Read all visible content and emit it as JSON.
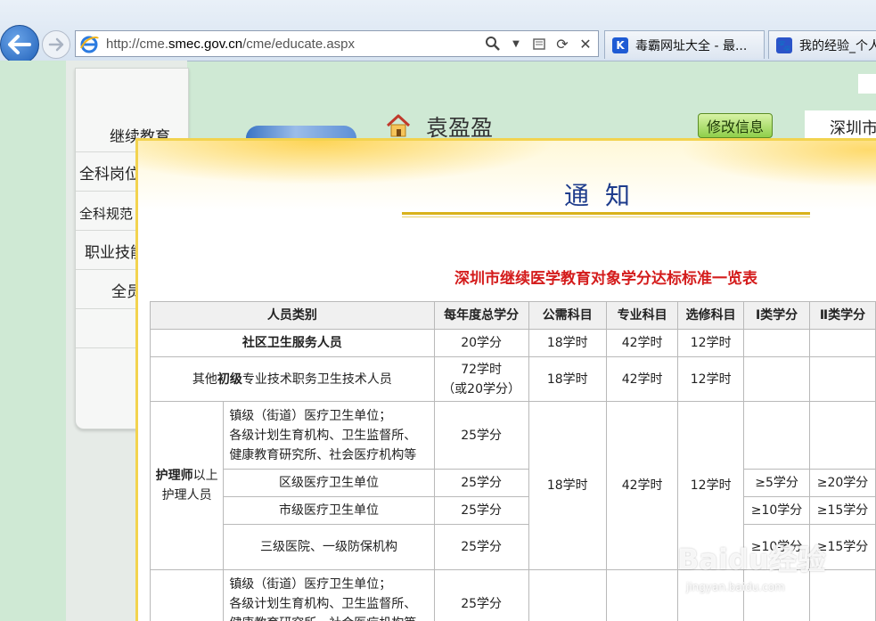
{
  "browser": {
    "url_prefix": "http://cme.",
    "url_domain": "smec.gov.cn",
    "url_path": "/cme/educate.aspx",
    "tabs": [
      {
        "label": "毒霸网址大全 - 最...",
        "icon": "kingsoft-icon",
        "icon_color": "#1e5bd4"
      },
      {
        "label": "我的经验_个人...",
        "icon": "baidu-paw-icon",
        "icon_color": "#2b54c9"
      }
    ]
  },
  "sidebar": {
    "items": [
      {
        "label": "继续教育"
      },
      {
        "label": "全科岗位"
      },
      {
        "label": "全科规范"
      },
      {
        "label": "职业技能"
      },
      {
        "label": "全员"
      }
    ]
  },
  "header": {
    "user_name": "袁盈盈",
    "edit_button": "修改信息",
    "city": "深圳市"
  },
  "notice": {
    "title": "通知",
    "subtitle": "深圳市继续医学教育对象学分达标标准一览表",
    "columns": [
      "人员类别",
      "每年度总学分",
      "公需科目",
      "专业科目",
      "选修科目",
      "Ⅰ类学分",
      "Ⅱ类学分"
    ],
    "rows": {
      "community": {
        "category": "社区卫生服务人员",
        "total": "20学分",
        "public": "18学时",
        "professional": "42学时",
        "elective": "12学时"
      },
      "other_junior": {
        "category_pre": "其他",
        "category_bold": "初级",
        "category_post": "专业技术职务卫生技术人员",
        "total_line1": "72学时",
        "total_line2": "（或20学分）",
        "public": "18学时",
        "professional": "42学时",
        "elective": "12学时"
      },
      "nurse_group": {
        "group_bold": "护理师",
        "group_rest1": "以上",
        "group_rest2": "护理人员",
        "public": "18学时",
        "professional": "42学时",
        "elective": "12学时",
        "sub": [
          {
            "unit_l1": "镇级（街道）医疗卫生单位；",
            "unit_l2": "各级计划生育机构、卫生监督所、",
            "unit_l3": "健康教育研究所、社会医疗机构等",
            "total": "25学分",
            "class1": "",
            "class2": ""
          },
          {
            "unit": "区级医疗卫生单位",
            "total": "25学分",
            "class1": "≥5学分",
            "class2": "≥20学分"
          },
          {
            "unit": "市级医疗卫生单位",
            "total": "25学分",
            "class1": "≥10学分",
            "class2": "≥15学分"
          },
          {
            "unit": "三级医院、一级防保机构",
            "total": "25学分",
            "class1": "≥10学分",
            "class2": "≥15学分"
          }
        ]
      },
      "next_group": {
        "unit_l1": "镇级（街道）医疗卫生单位；",
        "unit_l2": "各级计划生育机构、卫生监督所、",
        "unit_l3": "健康教育研究所、社会医疗机构等",
        "total": "25学分"
      }
    }
  },
  "watermark": {
    "text": "Baidu经验",
    "sub": "jingyan.baidu.com"
  }
}
